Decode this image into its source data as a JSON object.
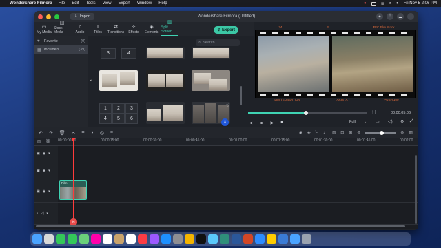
{
  "menubar": {
    "app_name": "Wondershare Filmora",
    "menus": [
      "File",
      "Edit",
      "Tools",
      "View",
      "Export",
      "Window",
      "Help"
    ],
    "clock": "Fri Nov 5  2:06 PM"
  },
  "window": {
    "title": "Wondershare Filmora (Untitled)",
    "import_label": "Import",
    "export_label": "Export"
  },
  "tabs": [
    {
      "label": "My Media",
      "icon": "folder-icon"
    },
    {
      "label": "Stock Media",
      "icon": "stock-icon"
    },
    {
      "label": "Audio",
      "icon": "music-icon"
    },
    {
      "label": "Titles",
      "icon": "text-icon"
    },
    {
      "label": "Transitions",
      "icon": "transition-icon"
    },
    {
      "label": "Effects",
      "icon": "effects-icon"
    },
    {
      "label": "Elements",
      "icon": "elements-icon"
    },
    {
      "label": "Split Screen",
      "icon": "split-screen-icon",
      "active": true
    }
  ],
  "sidebar": {
    "items": [
      {
        "label": "Favorite",
        "count": "(0)"
      },
      {
        "label": "Included",
        "count": "(39)"
      }
    ]
  },
  "search": {
    "placeholder": "Search"
  },
  "grid": {
    "numbers_a": [
      "3",
      "4"
    ],
    "numbers_b": [
      "1",
      "2",
      "3",
      "4",
      "5",
      "6"
    ]
  },
  "preview": {
    "film_top": [
      "24",
      "3",
      "FFC Film Stock"
    ],
    "film_bottom": [
      "LIMITED EDITION",
      "ARISTA",
      "PUSH 100"
    ],
    "timecode": "00:00:05:06",
    "progress": 0.49,
    "quality": "Full"
  },
  "ruler": {
    "ticks": [
      "00:00:00:00",
      "00:00:15:00",
      "00:00:30:00",
      "00:00:45:00",
      "00:01:00:00",
      "00:01:15:00",
      "00:01:30:00",
      "00:01:45:00",
      "00:02:00"
    ]
  },
  "timeline": {
    "clip_label": "Film",
    "zoom": 0.55
  },
  "colors": {
    "accent": "#3fd3b3",
    "playhead": "#ff3b3b"
  },
  "dock": {
    "apps": [
      "finder-icon",
      "launchpad-icon",
      "facetime-icon",
      "messages-icon",
      "maps-icon",
      "photos-icon",
      "calendar-icon",
      "contacts-icon",
      "reminders-icon",
      "music-icon",
      "podcasts-icon",
      "appstore-icon",
      "settings-icon",
      "chrome-icon",
      "tv-icon",
      "preview-icon",
      "filmora-icon",
      "word-icon",
      "powerpoint-icon",
      "zoom-icon",
      "notes-icon",
      "files-icon",
      "finder2-icon",
      "trash-icon"
    ]
  }
}
